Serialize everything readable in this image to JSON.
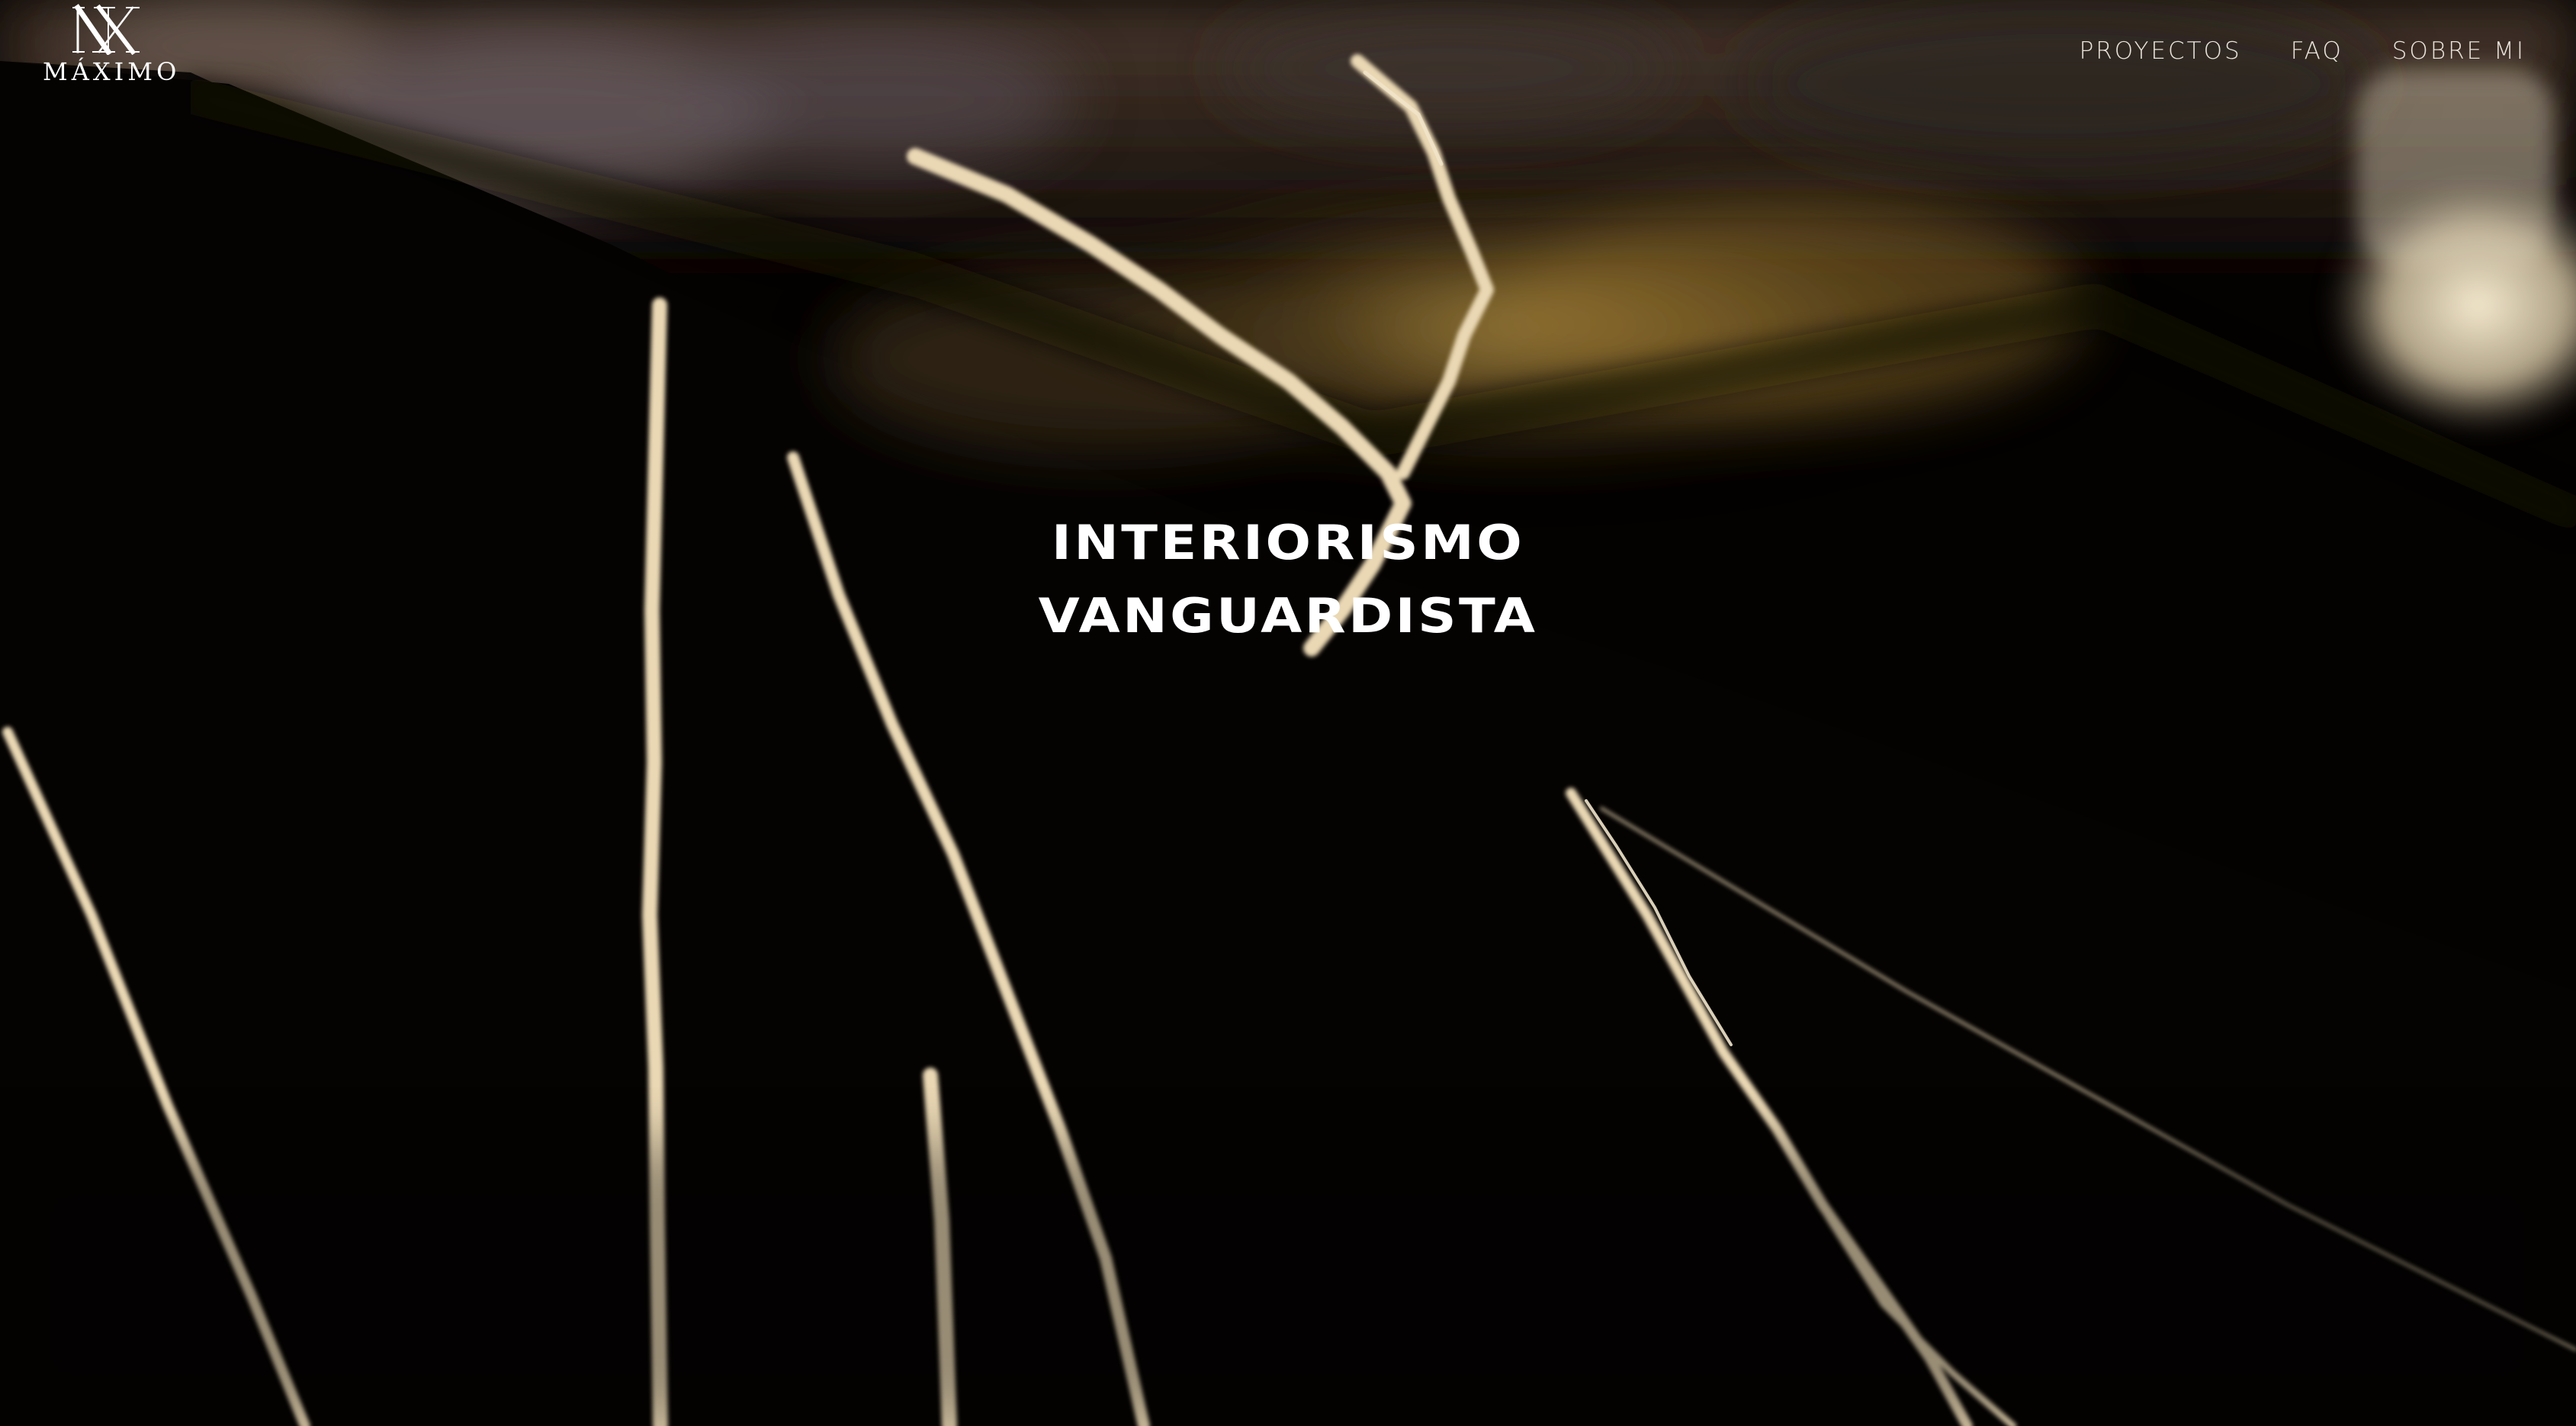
{
  "brand": {
    "logo_icon": "mx-monogram",
    "logo_text": "MÁXIMO"
  },
  "nav": {
    "items": [
      {
        "label": "PROYECTOS"
      },
      {
        "label": "FAQ"
      },
      {
        "label": "SOBRE MI"
      }
    ]
  },
  "hero": {
    "headline_line1": "INTERIORISMO",
    "headline_line2": "VANGUARDISTA",
    "background": "black-marble-gold-veins-video-still"
  },
  "colors": {
    "background": "#050302",
    "text": "#ffffff",
    "nav_text": "#e9e4dc",
    "vein": "#ead8b4",
    "gold_glow": "#8a6a2a"
  }
}
